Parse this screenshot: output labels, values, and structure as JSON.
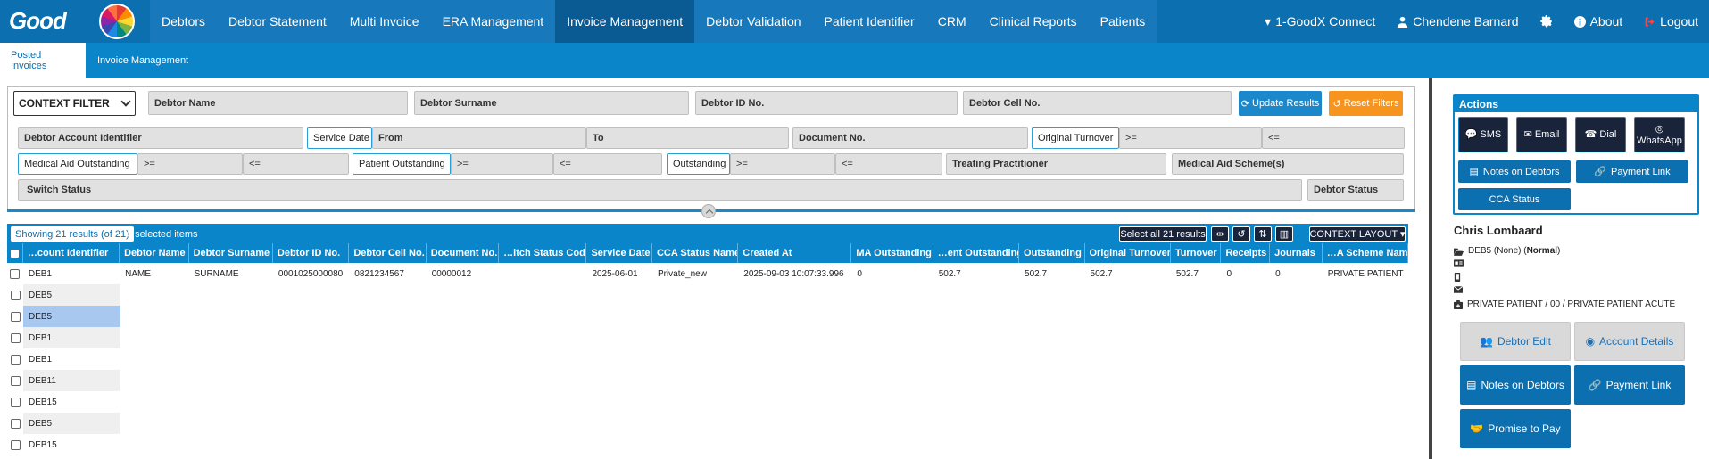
{
  "nav": {
    "brand": "Good",
    "items": [
      "Debtors",
      "Debtor Statement",
      "Multi Invoice",
      "ERA Management",
      "Invoice Management",
      "Debtor Validation",
      "Patient Identifier",
      "CRM",
      "Clinical Reports",
      "Patients"
    ],
    "connect": "1-GoodX Connect",
    "user": "Chendene Barnard",
    "about": "About",
    "logout": "Logout"
  },
  "subtabs": [
    "Posted Invoices",
    "Invoice Management"
  ],
  "filters": {
    "context": "CONTEXT FILTER",
    "debtor_name": "Debtor Name",
    "debtor_surname": "Debtor Surname",
    "debtor_id": "Debtor ID No.",
    "debtor_cell": "Debtor Cell No.",
    "update": "Update Results",
    "reset": "Reset Filters",
    "account_identifier": "Debtor Account Identifier",
    "service_date": "Service Date",
    "from": "From",
    "to": "To",
    "document_no": "Document No.",
    "original_turnover": "Original Turnover",
    "gte": ">=",
    "lte": "<=",
    "ma_outstanding": "Medical Aid Outstanding",
    "patient_outstanding": "Patient Outstanding",
    "outstanding": "Outstanding",
    "treating": "Treating Practitioner",
    "schemes": "Medical Aid Scheme(s)",
    "switch_status": "Switch Status",
    "debtor_status": "Debtor Status"
  },
  "grid": {
    "showing": "Showing 21 results (of 21)",
    "selected": "0 selected items",
    "select_all": "Select all 21 results",
    "context_layout": "CONTEXT LAYOUT",
    "columns": [
      "…count Identifier",
      "Debtor Name",
      "Debtor Surname",
      "Debtor ID No.",
      "Debtor Cell No.",
      "Document No.",
      "…itch Status Code",
      "Service Date",
      "CCA Status Name",
      "Created At",
      "MA Outstanding",
      "…ent Outstanding",
      "Outstanding",
      "Original Turnover",
      "Turnover",
      "Receipts",
      "Journals",
      "…A Scheme Name"
    ],
    "first_row": [
      "DEB1",
      "NAME",
      "SURNAME",
      "0001025000080",
      "0821234567",
      "00000012",
      "",
      "2025-06-01",
      "Private_new",
      "2025-09-03 10:07:33.996",
      "0",
      "502.7",
      "502.7",
      "502.7",
      "502.7",
      "0",
      "0",
      "PRIVATE PATIENT"
    ],
    "other_rows": [
      "DEB5",
      "DEB5",
      "DEB1",
      "DEB1",
      "DEB11",
      "DEB15",
      "DEB5",
      "DEB15"
    ]
  },
  "actions": {
    "title": "Actions",
    "sms": "SMS",
    "email": "Email",
    "dial": "Dial",
    "whatsapp": "WhatsApp",
    "notes": "Notes on Debtors",
    "payment": "Payment Link",
    "cca": "CCA Status"
  },
  "patient": {
    "name": "Chris Lombaard",
    "account": "DEB5 (None) (",
    "account_type": "Normal",
    "account_end": ")",
    "scheme": "PRIVATE PATIENT / 00 / PRIVATE PATIENT ACUTE"
  },
  "lower_actions": {
    "edit": "Debtor Edit",
    "account": "Account Details",
    "notes": "Notes on Debtors",
    "payment": "Payment Link",
    "promise": "Promise to Pay"
  },
  "colors": {
    "nav": "#0b6fb0",
    "active": "#0a5a94",
    "accent": "#0b85c9",
    "dark_btn": "#19233a",
    "reset": "#f7941d",
    "selected_row": "#a9c8f0"
  }
}
